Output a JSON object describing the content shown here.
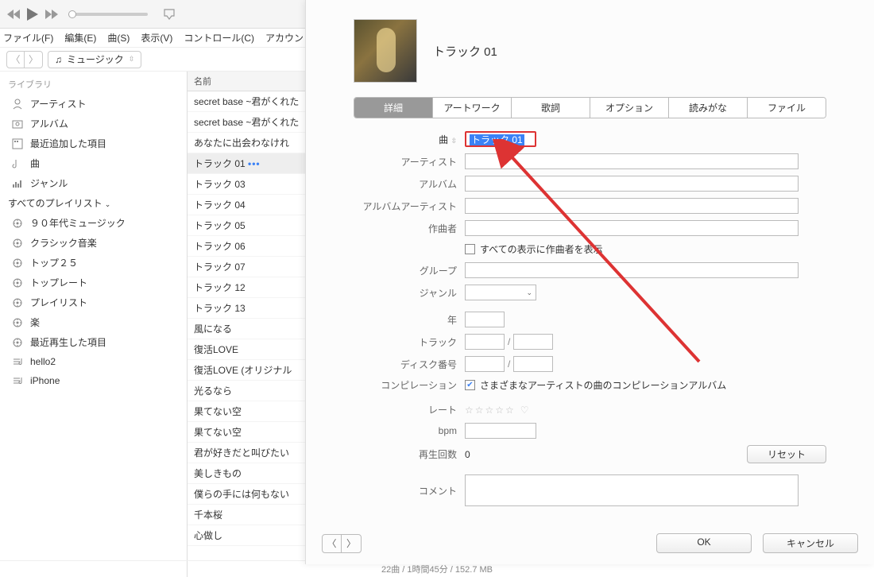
{
  "menubar": [
    "ファイル(F)",
    "編集(E)",
    "曲(S)",
    "表示(V)",
    "コントロール(C)",
    "アカウン"
  ],
  "subbar": {
    "dropdown": "ミュージック"
  },
  "sidebar": {
    "header1": "ライブラリ",
    "lib": [
      {
        "label": "アーティスト"
      },
      {
        "label": "アルバム"
      },
      {
        "label": "最近追加した項目"
      },
      {
        "label": "曲"
      },
      {
        "label": "ジャンル"
      }
    ],
    "header2": "すべてのプレイリスト",
    "pl": [
      {
        "label": "９０年代ミュージック"
      },
      {
        "label": "クラシック音楽"
      },
      {
        "label": "トップ２５"
      },
      {
        "label": "トップレート"
      },
      {
        "label": "プレイリスト"
      },
      {
        "label": "楽"
      },
      {
        "label": "最近再生した項目"
      },
      {
        "label": "hello2"
      },
      {
        "label": "iPhone"
      }
    ]
  },
  "tracklist": {
    "header": "名前",
    "rows": [
      "secret base ~君がくれた",
      "secret base ~君がくれた",
      "あなたに出会わなけれ",
      "トラック 01",
      "トラック 03",
      "トラック 04",
      "トラック 05",
      "トラック 06",
      "トラック 07",
      "トラック 12",
      "トラック 13",
      "風になる",
      "復活LOVE",
      "復活LOVE (オリジナル",
      "光るなら",
      "果てない空",
      "果てない空",
      "君が好きだと叫びたい",
      "美しきもの",
      "僕らの手には何もない",
      "千本桜",
      "心做し"
    ],
    "sel_index": 3
  },
  "dialog": {
    "title": "トラック 01",
    "tabs": [
      "詳細",
      "アートワーク",
      "歌詞",
      "オプション",
      "読みがな",
      "ファイル"
    ],
    "labels": {
      "song": "曲",
      "artist": "アーティスト",
      "album": "アルバム",
      "albumartist": "アルバムアーティスト",
      "composer": "作曲者",
      "composer_chk": "すべての表示に作曲者を表示",
      "group": "グループ",
      "genre": "ジャンル",
      "year": "年",
      "track": "トラック",
      "disc": "ディスク番号",
      "compilation": "コンピレーション",
      "compilation_chk": "さまざまなアーティストの曲のコンピレーションアルバム",
      "rate": "レート",
      "bpm": "bpm",
      "playcount": "再生回数",
      "reset": "リセット",
      "comment": "コメント"
    },
    "values": {
      "song": "トラック 01",
      "playcount": "0"
    },
    "buttons": {
      "ok": "OK",
      "cancel": "キャンセル"
    }
  },
  "statusbar": "22曲 / 1時間45分 / 152.7 MB"
}
